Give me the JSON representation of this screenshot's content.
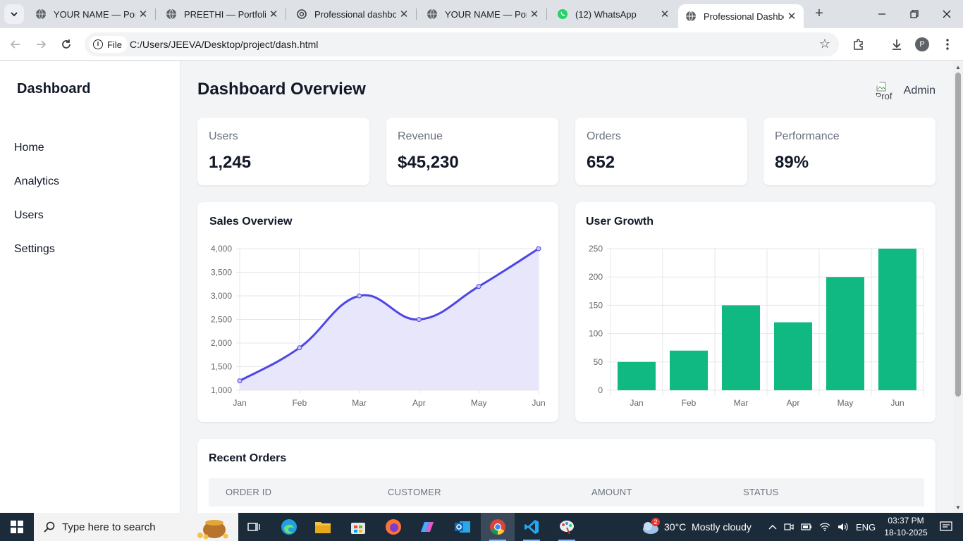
{
  "browser": {
    "tabs": [
      {
        "title": "YOUR NAME — Portfolio",
        "icon": "globe-icon",
        "active": false
      },
      {
        "title": "PREETHI — Portfolio",
        "icon": "globe-icon",
        "active": false
      },
      {
        "title": "Professional dashboard",
        "icon": "chatgpt-icon",
        "active": false
      },
      {
        "title": "YOUR NAME — Portfolio",
        "icon": "globe-icon",
        "active": false
      },
      {
        "title": "(12) WhatsApp",
        "icon": "whatsapp-icon",
        "active": false
      },
      {
        "title": "Professional Dashboard",
        "icon": "globe-icon",
        "active": true
      }
    ],
    "chip_label": "File",
    "url": "C:/Users/JEEVA/Desktop/project/dash.html",
    "profile_initial": "P"
  },
  "sidebar": {
    "brand": "Dashboard",
    "items": [
      {
        "label": "Home"
      },
      {
        "label": "Analytics"
      },
      {
        "label": "Users"
      },
      {
        "label": "Settings"
      }
    ]
  },
  "header": {
    "title": "Dashboard Overview",
    "avatar_alt": "Prof",
    "user": "Admin"
  },
  "stats": [
    {
      "label": "Users",
      "value": "1,245"
    },
    {
      "label": "Revenue",
      "value": "$45,230"
    },
    {
      "label": "Orders",
      "value": "652"
    },
    {
      "label": "Performance",
      "value": "89%"
    }
  ],
  "chart_data": [
    {
      "type": "line",
      "title": "Sales Overview",
      "categories": [
        "Jan",
        "Feb",
        "Mar",
        "Apr",
        "May",
        "Jun"
      ],
      "series": [
        {
          "values": [
            1200,
            1900,
            3000,
            2500,
            3200,
            4000
          ]
        }
      ],
      "yticks": [
        "1,000",
        "1,500",
        "2,000",
        "2,500",
        "3,000",
        "3,500",
        "4,000"
      ],
      "ylim": [
        1000,
        4000
      ],
      "color": "#4f46e5",
      "fill": "#e8e6fb",
      "grid": true
    },
    {
      "type": "bar",
      "title": "User Growth",
      "categories": [
        "Jan",
        "Feb",
        "Mar",
        "Apr",
        "May",
        "Jun"
      ],
      "series": [
        {
          "values": [
            50,
            70,
            150,
            120,
            200,
            250
          ]
        }
      ],
      "yticks": [
        "0",
        "50",
        "100",
        "150",
        "200",
        "250"
      ],
      "ylim": [
        0,
        250
      ],
      "color": "#10b981",
      "grid": true
    }
  ],
  "orders": {
    "title": "Recent Orders",
    "columns": [
      "ORDER ID",
      "CUSTOMER",
      "AMOUNT",
      "STATUS"
    ]
  },
  "taskbar": {
    "search_placeholder": "Type here to search",
    "weather": "30°C  Mostly cloudy",
    "weather_badge": "2",
    "language": "ENG",
    "time": "03:37 PM",
    "date": "18-10-2025"
  }
}
